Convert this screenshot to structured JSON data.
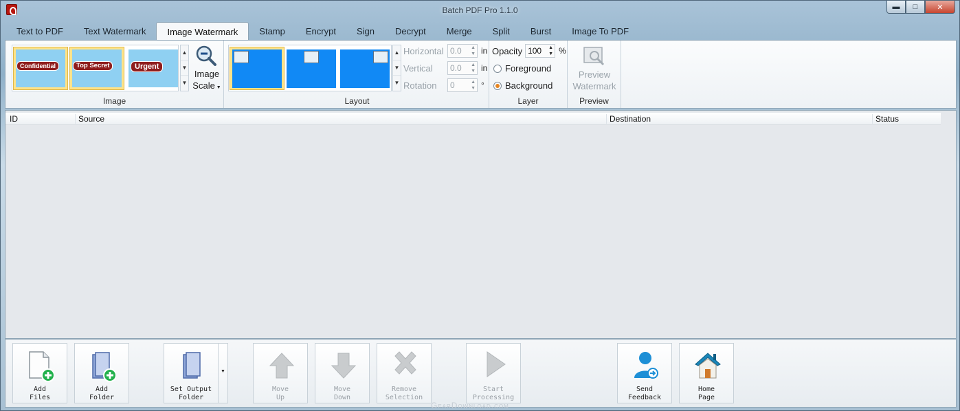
{
  "window": {
    "title": "Batch PDF Pro 1.1.0",
    "minimize": "▬",
    "maximize": "□",
    "close": "✕"
  },
  "tabs": [
    {
      "label": "Text to PDF"
    },
    {
      "label": "Text Watermark"
    },
    {
      "label": "Image Watermark"
    },
    {
      "label": "Stamp"
    },
    {
      "label": "Encrypt"
    },
    {
      "label": "Sign"
    },
    {
      "label": "Decrypt"
    },
    {
      "label": "Merge"
    },
    {
      "label": "Split"
    },
    {
      "label": "Burst"
    },
    {
      "label": "Image To PDF"
    }
  ],
  "active_tab": "Image Watermark",
  "ribbon": {
    "image": {
      "group_label": "Image",
      "stamps": [
        "Confidential",
        "Top Secret",
        "Urgent"
      ],
      "scale_label_1": "Image",
      "scale_label_2": "Scale"
    },
    "layout": {
      "group_label": "Layout",
      "horizontal_label": "Horizontal",
      "horizontal_value": "0.0",
      "horizontal_unit": "in",
      "vertical_label": "Vertical",
      "vertical_value": "0.0",
      "vertical_unit": "in",
      "rotation_label": "Rotation",
      "rotation_value": "0",
      "rotation_unit": "°"
    },
    "layer": {
      "group_label": "Layer",
      "opacity_label": "Opacity",
      "opacity_value": "100",
      "opacity_unit": "%",
      "foreground_label": "Foreground",
      "background_label": "Background",
      "selected": "Background"
    },
    "preview": {
      "group_label": "Preview",
      "button_line1": "Preview",
      "button_line2": "Watermark"
    }
  },
  "grid": {
    "columns": [
      "ID",
      "Source",
      "Destination",
      "Status"
    ],
    "rows": []
  },
  "toolbar": {
    "add_files": [
      "Add",
      "Files"
    ],
    "add_folder": [
      "Add",
      "Folder"
    ],
    "set_output": [
      "Set Output",
      "Folder"
    ],
    "move_up": [
      "Move",
      "Up"
    ],
    "move_down": [
      "Move",
      "Down"
    ],
    "remove": [
      "Remove",
      "Selection"
    ],
    "start": [
      "Start",
      "Processing"
    ],
    "feedback": [
      "Send",
      "Feedback"
    ],
    "home": [
      "Home",
      "Page"
    ]
  },
  "watermark": "GearDownload.com",
  "colors": {
    "accent_green": "#22b14c",
    "selection_gold": "#fde38a",
    "thumb_blue": "#1189f5"
  }
}
